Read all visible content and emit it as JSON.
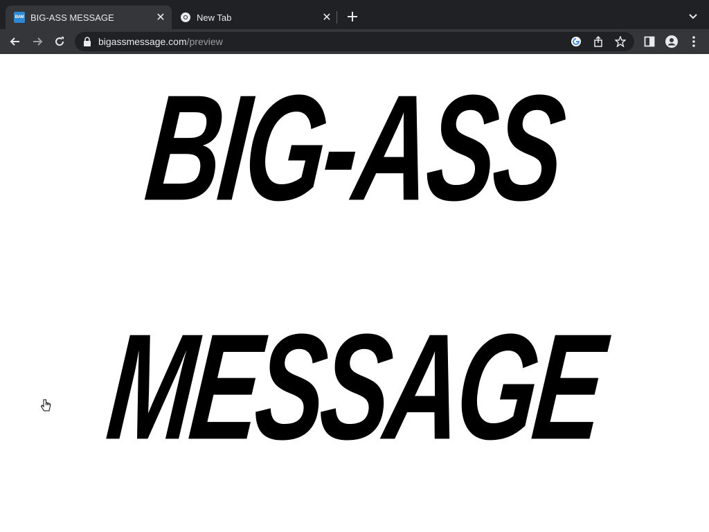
{
  "browser": {
    "tabs": [
      {
        "title": "BIG-ASS MESSAGE",
        "favicon_text": "BAM",
        "active": true
      },
      {
        "title": "New Tab",
        "active": false
      }
    ],
    "address": {
      "domain": "bigassmessage.com",
      "path": "/preview"
    },
    "colors": {
      "tabbar_bg": "#202124",
      "toolbar_bg": "#35363a",
      "favicon_bg": "#2b8ad8"
    }
  },
  "page": {
    "message_line_1": "BIG-ASS",
    "message_line_2": "MESSAGE"
  }
}
